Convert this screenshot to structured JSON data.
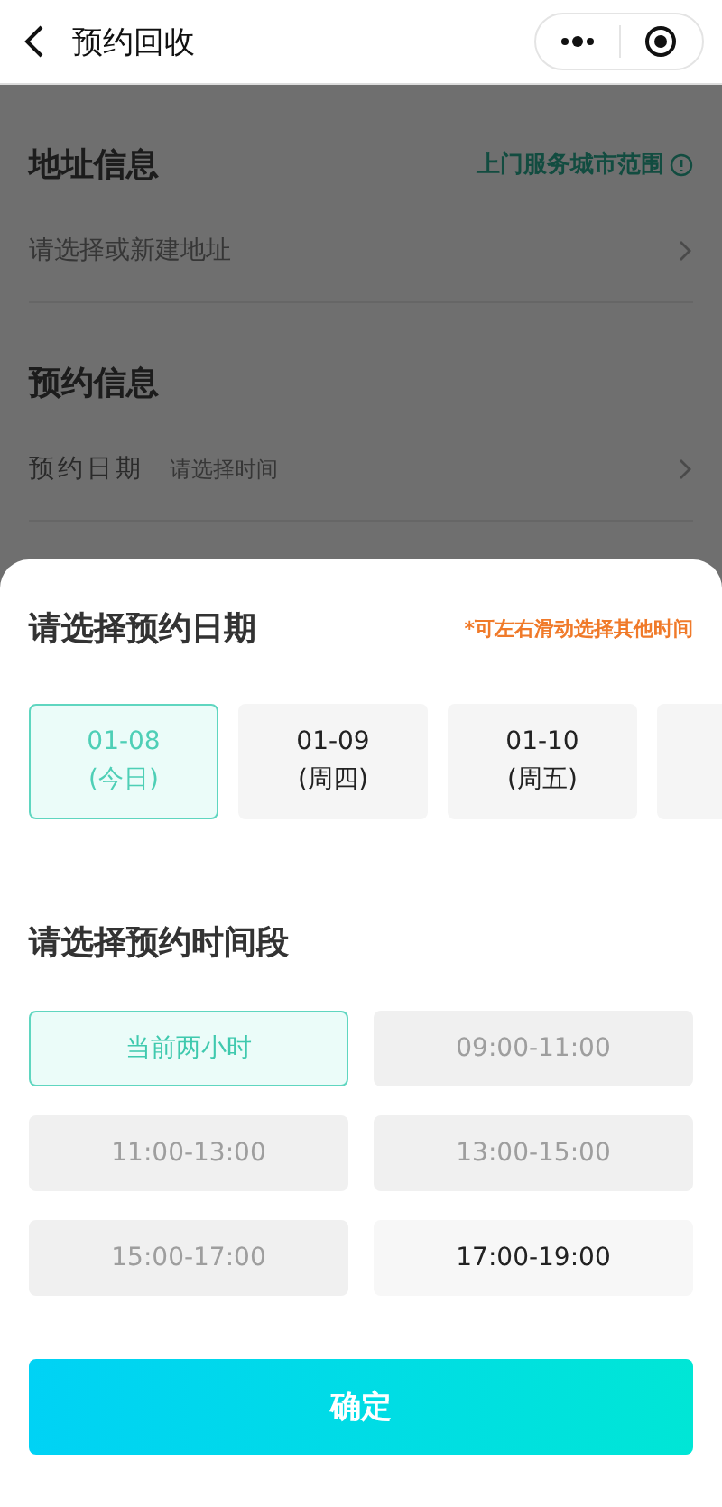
{
  "header": {
    "title": "预约回收"
  },
  "address": {
    "title": "地址信息",
    "link": "上门服务城市范围",
    "placeholder": "请选择或新建地址"
  },
  "booking": {
    "title": "预约信息",
    "label": "预约日期",
    "placeholder": "请选择时间"
  },
  "sheet": {
    "title": "请选择预约日期",
    "hint": "*可左右滑动选择其他时间",
    "dates": [
      {
        "date": "01-08",
        "day": "(今日)",
        "selected": true
      },
      {
        "date": "01-09",
        "day": "(周四)",
        "selected": false
      },
      {
        "date": "01-10",
        "day": "(周五)",
        "selected": false
      }
    ],
    "slot_title": "请选择预约时间段",
    "slots": [
      {
        "label": "当前两小时",
        "selected": true,
        "disabled": false
      },
      {
        "label": "09:00-11:00",
        "selected": false,
        "disabled": true
      },
      {
        "label": "11:00-13:00",
        "selected": false,
        "disabled": true
      },
      {
        "label": "13:00-15:00",
        "selected": false,
        "disabled": true
      },
      {
        "label": "15:00-17:00",
        "selected": false,
        "disabled": true
      },
      {
        "label": "17:00-19:00",
        "selected": false,
        "disabled": false
      }
    ],
    "confirm": "确定"
  }
}
